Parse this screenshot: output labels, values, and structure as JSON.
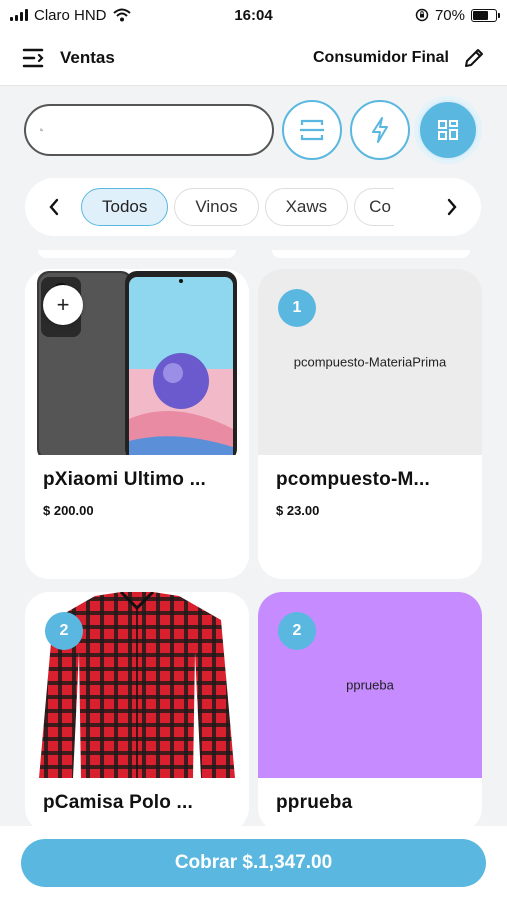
{
  "status_bar": {
    "carrier": "Claro HND",
    "time": "16:04",
    "battery": "70%",
    "battery_level": 0.7
  },
  "header": {
    "title": "Ventas",
    "customer": "Consumidor Final"
  },
  "search": {
    "placeholder": ""
  },
  "categories": [
    "Todos",
    "Vinos",
    "Xaws",
    "Co"
  ],
  "products": [
    {
      "name": "pXiaomi Ultimo ...",
      "price": "$ 200.00",
      "thumb_text": "",
      "badge": "+"
    },
    {
      "name": "pcompuesto-M...",
      "price": "$ 23.00",
      "thumb_text": "pcompuesto-MateriaPrima",
      "badge": "1"
    },
    {
      "name": "pCamisa Polo ...",
      "price": "",
      "thumb_text": "",
      "badge": "2"
    },
    {
      "name": "pprueba",
      "price": "",
      "thumb_text": "pprueba",
      "badge": "2"
    }
  ],
  "cobrar": {
    "label": "Cobrar $.1,347.00"
  },
  "colors": {
    "accent": "#5ab8e0",
    "purple_tile": "#c58bff"
  }
}
